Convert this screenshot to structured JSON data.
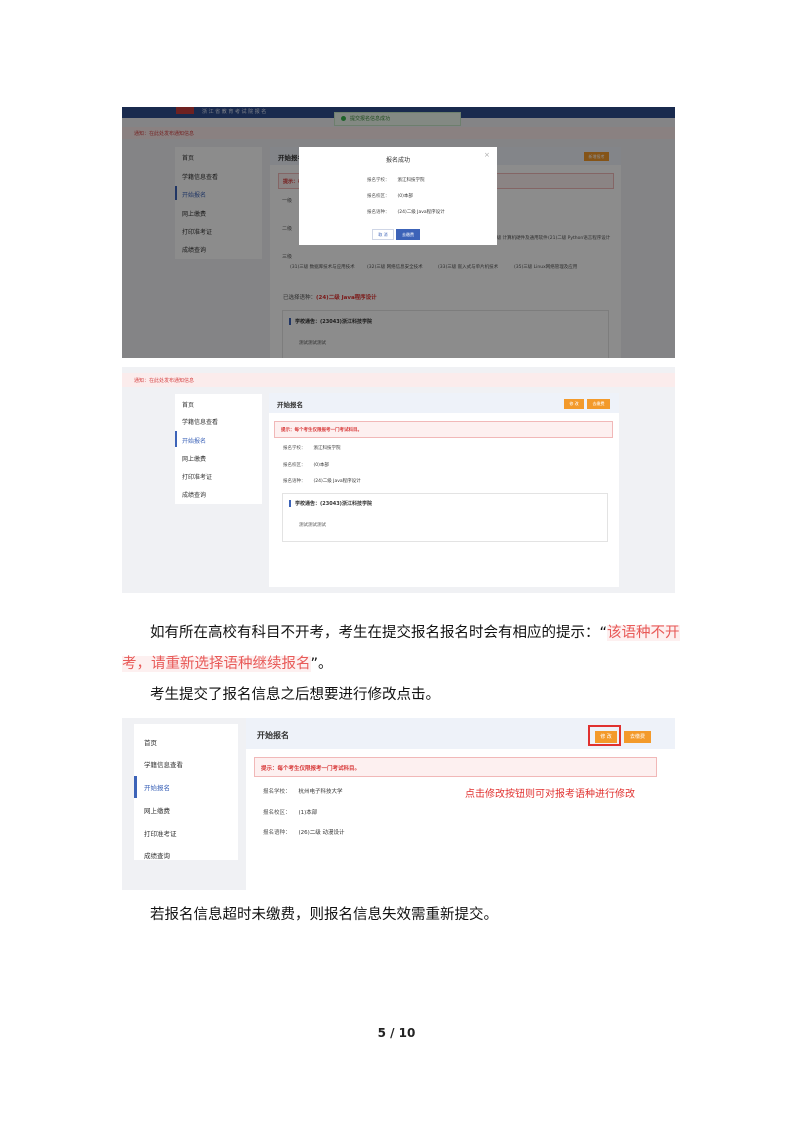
{
  "shot1": {
    "site_title": "浙 江 省 教 育 考 试 院 报 名",
    "toast": "提交报名信息成功",
    "notice": "通知：在此处发布通知信息",
    "sidebar": [
      "首页",
      "学籍信息查看",
      "开始报名",
      "网上缴费",
      "打印准考证",
      "成绩查询"
    ],
    "panel_title": "开始报名",
    "button": "新增报考",
    "tip": "提示：每",
    "groups": [
      "一级",
      "二级",
      "三级"
    ],
    "lv2_items": [
      "(21)二级 计算机硬件及通用软件",
      "(21)二级 Python语言程序设计"
    ],
    "lv3_items": [
      "(31)三级 数据库技术与应用技术",
      "(32)三级 网络信息安全技术",
      "(33)三级 嵌入式与单片机技术",
      "(35)三级 Linux网络管理及应用"
    ],
    "selected_label": "已选择语种：",
    "selected_value": "(24)二级 Java程序设计",
    "school_notice": "学校通告：(23043)浙江科技学院",
    "notice_body": "测试测试测试",
    "modal": {
      "title": "报名成功",
      "close": "×",
      "rows": [
        {
          "label": "报名学校：",
          "value": "浙江科技学院"
        },
        {
          "label": "报名校区：",
          "value": "(0)本部"
        },
        {
          "label": "报名语种：",
          "value": "(24)二级 Java程序设计"
        }
      ],
      "btn_cancel": "取 消",
      "btn_ok": "去缴费"
    }
  },
  "shot2": {
    "notice": "通知：在此处发布通知信息",
    "sidebar": [
      "首页",
      "学籍信息查看",
      "开始报名",
      "网上缴费",
      "打印准考证",
      "成绩查询"
    ],
    "panel_title": "开始报名",
    "btn_edit": "修 改",
    "btn_pay": "去缴费",
    "tip": "提示：每个考生仅限报考一门考试科目。",
    "rows": [
      {
        "label": "报名学校：",
        "value": "浙江科技学院"
      },
      {
        "label": "报名校区：",
        "value": "(0)本部"
      },
      {
        "label": "报名语种：",
        "value": "(24)二级 Java程序设计"
      }
    ],
    "school_notice": "学校通告：(23043)浙江科技学院",
    "notice_body": "测试测试测试"
  },
  "para1_line1_a": "如有所在高校有科目不开考，考生在提交报名报名时会有相应的提示：“",
  "para1_line1_hl": "该语种不开",
  "para1_line2_hl": "考，请重新选择语种继续报名",
  "para1_line2_end": "”。",
  "para2": "考生提交了报名信息之后想要进行修改点击。",
  "shot3": {
    "sidebar": [
      "首页",
      "学籍信息查看",
      "开始报名",
      "网上缴费",
      "打印准考证",
      "成绩查询"
    ],
    "panel_title": "开始报名",
    "btn_edit": "修 改",
    "btn_pay": "去缴费",
    "tip": "提示：每个考生仅限报考一门考试科目。",
    "rows": [
      {
        "label": "报名学校：",
        "value": "杭州电子科技大学"
      },
      {
        "label": "报名校区：",
        "value": "(1)本部"
      },
      {
        "label": "报名语种：",
        "value": "(26)二级 动漫设计"
      }
    ],
    "annotation": "点击修改按钮则可对报考语种进行修改"
  },
  "para3": "若报名信息超时未缴费，则报名信息失效需重新提交。",
  "page_number": "5 / 10",
  "colors": {
    "accent": "#3c63b8",
    "button": "#f39a2b",
    "alert": "#e0312f",
    "highlight": "#e85a58"
  }
}
